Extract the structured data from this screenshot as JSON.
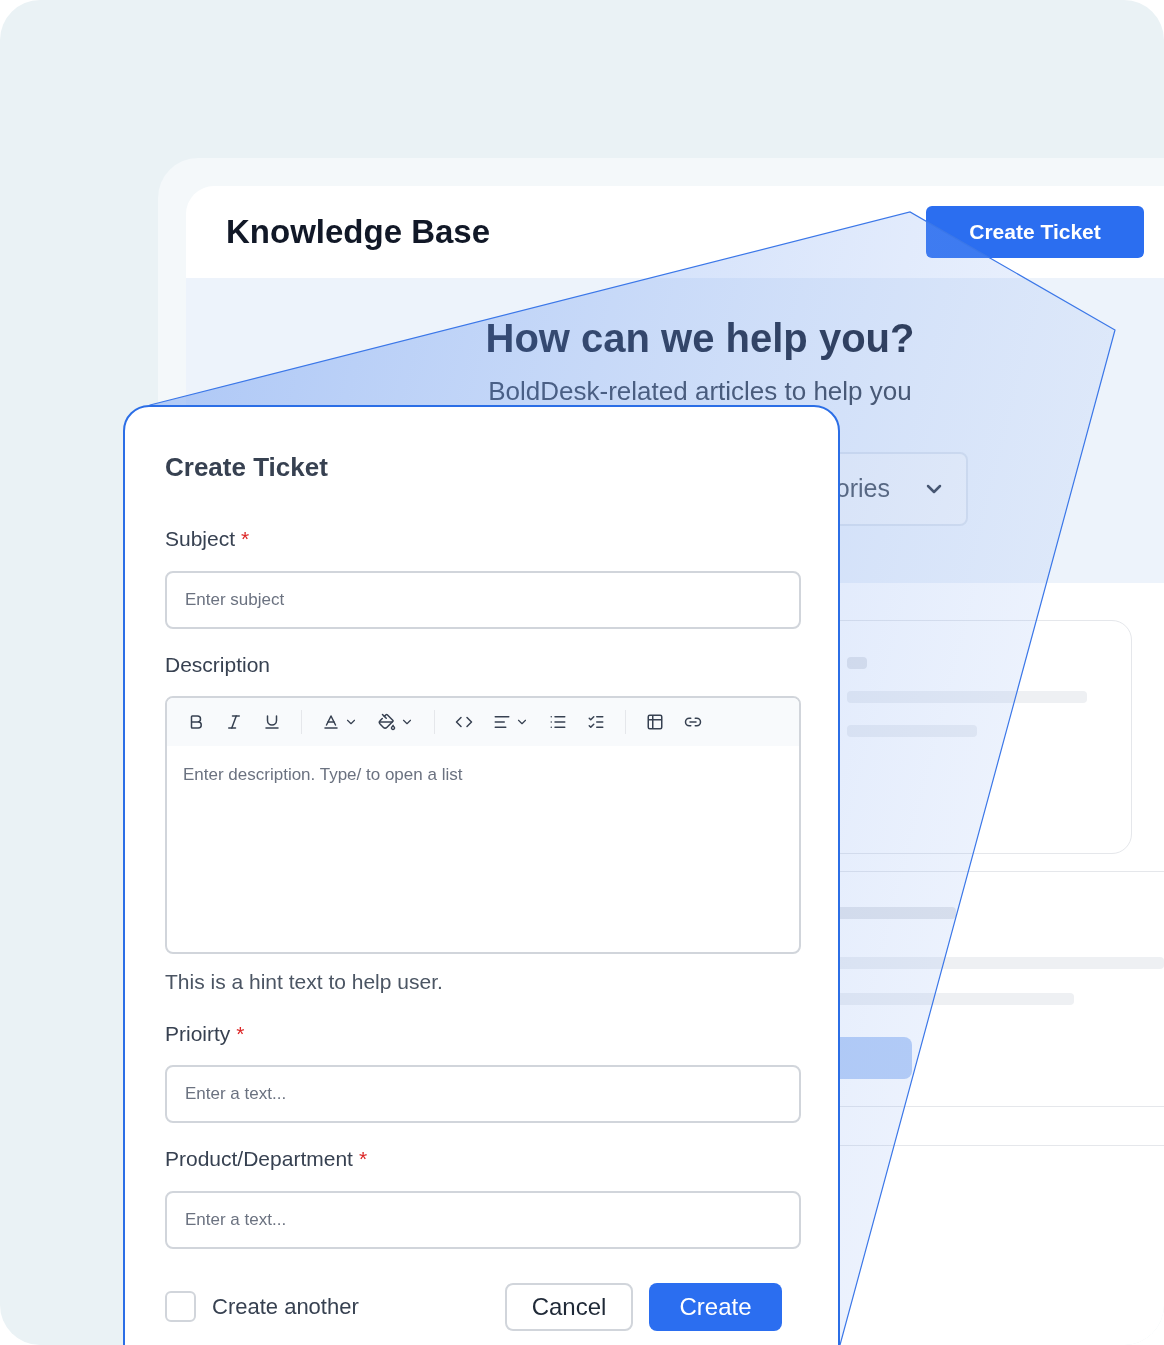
{
  "page": {
    "title": "Knowledge Base",
    "header_button": "Create Ticket",
    "hero_title": "How can we help you?",
    "hero_subtitle": "BoldDesk-related articles to help you",
    "category_dropdown": "ories"
  },
  "dialog": {
    "title": "Create Ticket",
    "fields": [
      {
        "kind": "input",
        "label": "Subject",
        "required_mark": "*",
        "placeholder": "Enter subject"
      },
      {
        "kind": "editor",
        "label": "Description",
        "placeholder": "Enter description. Type/ to open a list",
        "hint": "This is a hint text to help user."
      },
      {
        "kind": "input",
        "label": "Prioirty",
        "required_mark": "*",
        "placeholder": "Enter a text..."
      },
      {
        "kind": "input",
        "label": "Product/Department",
        "required_mark": "*",
        "placeholder": "Enter a text..."
      }
    ],
    "create_another": {
      "label": "Create another",
      "checked": false
    },
    "buttons": [
      {
        "kind": "secondary",
        "label": "Cancel"
      },
      {
        "kind": "primary",
        "label": "Create"
      }
    ]
  }
}
